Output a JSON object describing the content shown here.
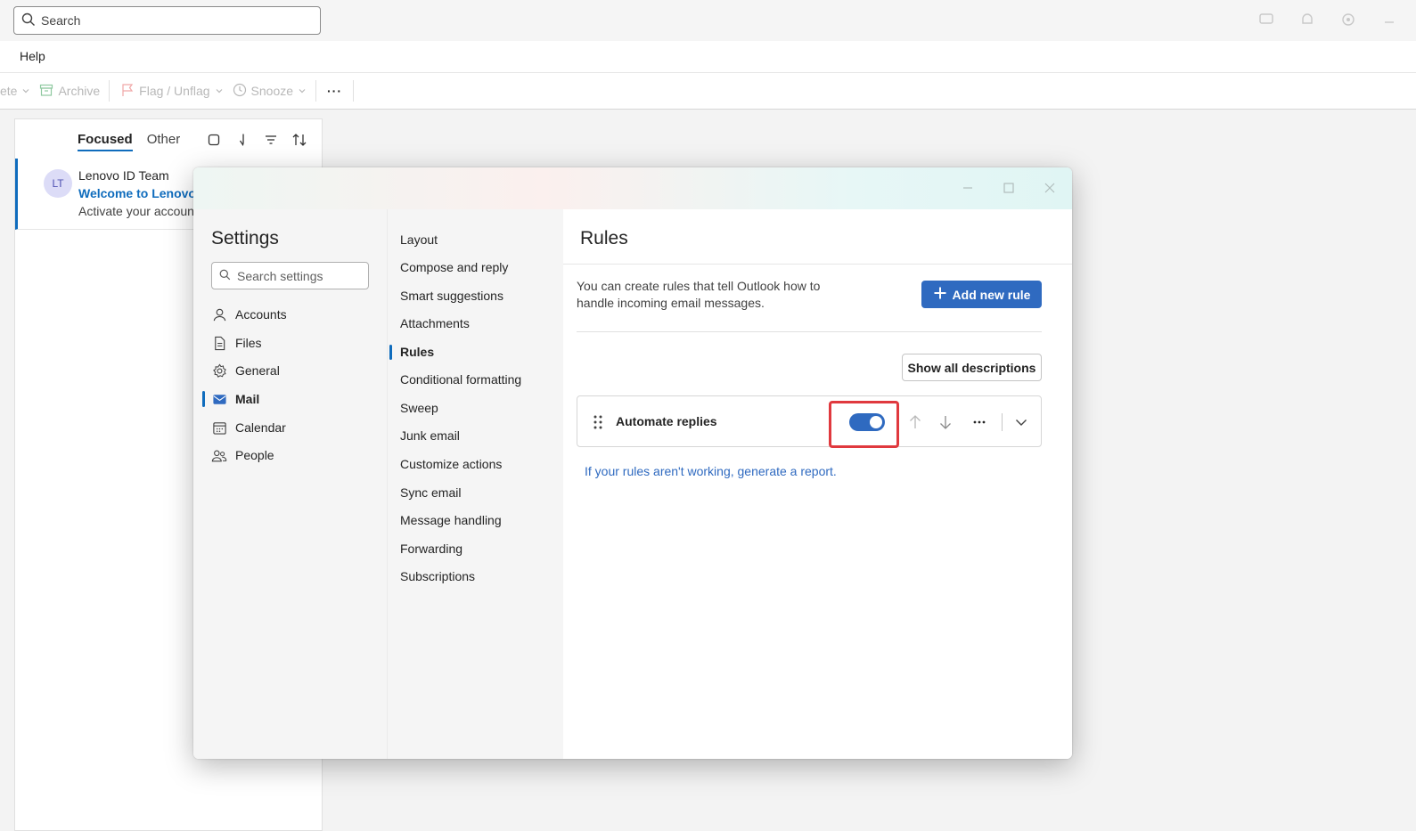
{
  "topbar": {
    "search_label": "Search",
    "icons": [
      "chat-icon",
      "bell-icon",
      "gear-icon",
      "minimize-icon"
    ]
  },
  "menubar": {
    "help": "Help"
  },
  "toolbar": {
    "delete_partial": "ete",
    "archive": "Archive",
    "flag": "Flag / Unflag",
    "snooze": "Snooze",
    "more": "···"
  },
  "message_list": {
    "tabs": {
      "focused": "Focused",
      "other": "Other"
    },
    "messages": [
      {
        "avatar": "LT",
        "from": "Lenovo ID Team",
        "subject": "Welcome to Lenovo I",
        "preview": "Activate your account"
      }
    ]
  },
  "settings": {
    "title": "Settings",
    "search_placeholder": "Search settings",
    "categories": [
      {
        "label": "Accounts",
        "icon": "person-icon"
      },
      {
        "label": "Files",
        "icon": "document-icon"
      },
      {
        "label": "General",
        "icon": "gear-icon"
      },
      {
        "label": "Mail",
        "icon": "mail-icon",
        "active": true
      },
      {
        "label": "Calendar",
        "icon": "calendar-icon"
      },
      {
        "label": "People",
        "icon": "people-icon"
      }
    ],
    "mail_sections": [
      "Layout",
      "Compose and reply",
      "Smart suggestions",
      "Attachments",
      "Rules",
      "Conditional formatting",
      "Sweep",
      "Junk email",
      "Customize actions",
      "Sync email",
      "Message handling",
      "Forwarding",
      "Subscriptions"
    ],
    "active_section": "Rules"
  },
  "rules": {
    "title": "Rules",
    "description": "You can create rules that tell Outlook how to handle incoming email messages.",
    "add_button": "Add new rule",
    "show_button": "Show all descriptions",
    "items": [
      {
        "name": "Automate replies",
        "enabled": true
      }
    ],
    "report_link": "If your rules aren't working, generate a report."
  },
  "colors": {
    "accent": "#2f6ac0",
    "highlight": "#e0393e"
  }
}
